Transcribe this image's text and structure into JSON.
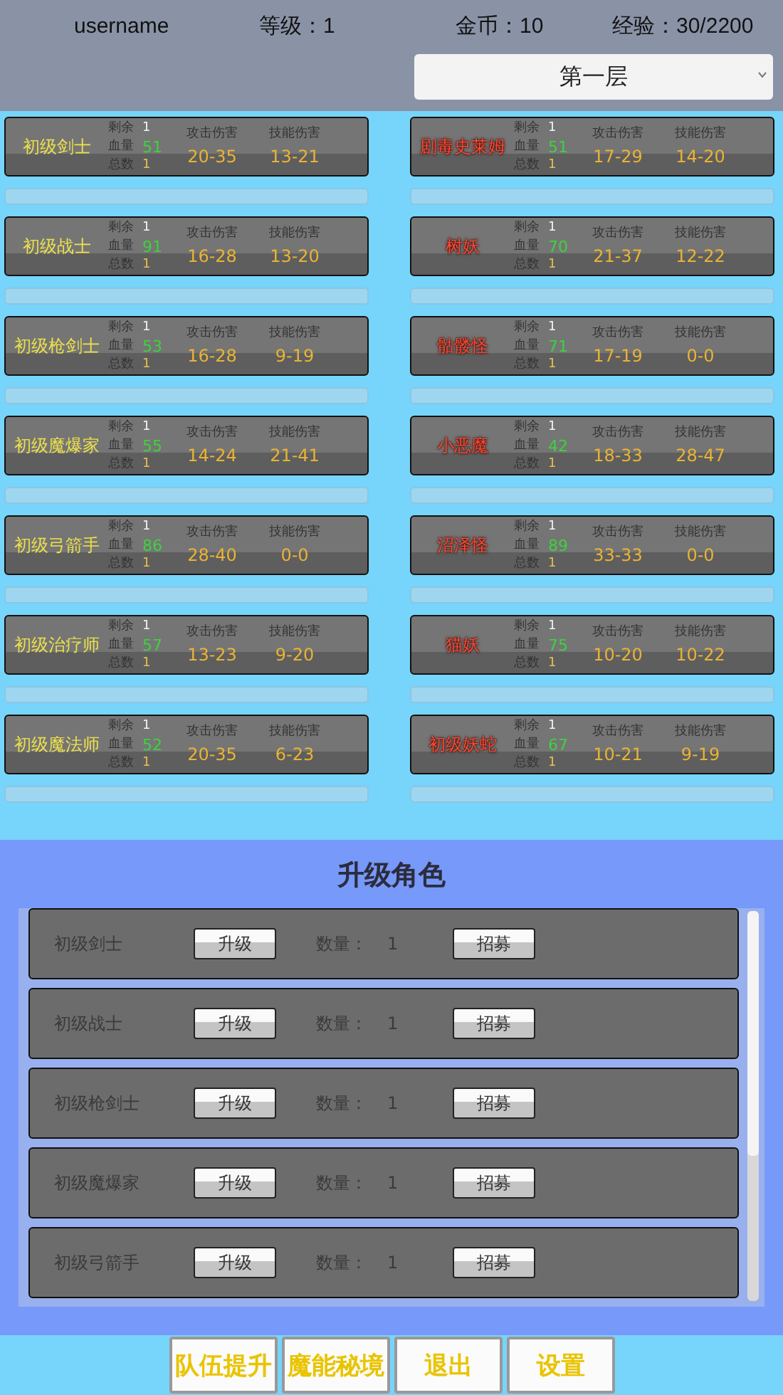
{
  "stats": [
    "username",
    "等级：1",
    "金币：10",
    "经验：30/2200"
  ],
  "floor_select": {
    "value": "第一层"
  },
  "heroes": [
    {
      "name": "初级剑士",
      "remaining_label": "剩余",
      "remaining": "1",
      "hp_label": "血量",
      "hp": "51",
      "total_label": "总数",
      "total": "1",
      "attack_label": "攻击伤害",
      "attack": "20-35",
      "skill_label": "技能伤害",
      "skill": "13-21"
    },
    {
      "name": "初级战士",
      "remaining_label": "剩余",
      "remaining": "1",
      "hp_label": "血量",
      "hp": "91",
      "total_label": "总数",
      "total": "1",
      "attack_label": "攻击伤害",
      "attack": "16-28",
      "skill_label": "技能伤害",
      "skill": "13-20"
    },
    {
      "name": "初级枪剑士",
      "remaining_label": "剩余",
      "remaining": "1",
      "hp_label": "血量",
      "hp": "53",
      "total_label": "总数",
      "total": "1",
      "attack_label": "攻击伤害",
      "attack": "16-28",
      "skill_label": "技能伤害",
      "skill": "9-19"
    },
    {
      "name": "初级魔爆家",
      "remaining_label": "剩余",
      "remaining": "1",
      "hp_label": "血量",
      "hp": "55",
      "total_label": "总数",
      "total": "1",
      "attack_label": "攻击伤害",
      "attack": "14-24",
      "skill_label": "技能伤害",
      "skill": "21-41"
    },
    {
      "name": "初级弓箭手",
      "remaining_label": "剩余",
      "remaining": "1",
      "hp_label": "血量",
      "hp": "86",
      "total_label": "总数",
      "total": "1",
      "attack_label": "攻击伤害",
      "attack": "28-40",
      "skill_label": "技能伤害",
      "skill": "0-0"
    },
    {
      "name": "初级治疗师",
      "remaining_label": "剩余",
      "remaining": "1",
      "hp_label": "血量",
      "hp": "57",
      "total_label": "总数",
      "total": "1",
      "attack_label": "攻击伤害",
      "attack": "13-23",
      "skill_label": "技能伤害",
      "skill": "9-20"
    },
    {
      "name": "初级魔法师",
      "remaining_label": "剩余",
      "remaining": "1",
      "hp_label": "血量",
      "hp": "52",
      "total_label": "总数",
      "total": "1",
      "attack_label": "攻击伤害",
      "attack": "20-35",
      "skill_label": "技能伤害",
      "skill": "6-23"
    }
  ],
  "monsters": [
    {
      "name": "剧毒史莱姆",
      "remaining_label": "剩余",
      "remaining": "1",
      "hp_label": "血量",
      "hp": "51",
      "total_label": "总数",
      "total": "1",
      "attack_label": "攻击伤害",
      "attack": "17-29",
      "skill_label": "技能伤害",
      "skill": "14-20"
    },
    {
      "name": "树妖",
      "remaining_label": "剩余",
      "remaining": "1",
      "hp_label": "血量",
      "hp": "70",
      "total_label": "总数",
      "total": "1",
      "attack_label": "攻击伤害",
      "attack": "21-37",
      "skill_label": "技能伤害",
      "skill": "12-22"
    },
    {
      "name": "骷髅怪",
      "remaining_label": "剩余",
      "remaining": "1",
      "hp_label": "血量",
      "hp": "71",
      "total_label": "总数",
      "total": "1",
      "attack_label": "攻击伤害",
      "attack": "17-19",
      "skill_label": "技能伤害",
      "skill": "0-0"
    },
    {
      "name": "小恶魔",
      "remaining_label": "剩余",
      "remaining": "1",
      "hp_label": "血量",
      "hp": "42",
      "total_label": "总数",
      "total": "1",
      "attack_label": "攻击伤害",
      "attack": "18-33",
      "skill_label": "技能伤害",
      "skill": "28-47"
    },
    {
      "name": "沼泽怪",
      "remaining_label": "剩余",
      "remaining": "1",
      "hp_label": "血量",
      "hp": "89",
      "total_label": "总数",
      "total": "1",
      "attack_label": "攻击伤害",
      "attack": "33-33",
      "skill_label": "技能伤害",
      "skill": "0-0"
    },
    {
      "name": "猫妖",
      "remaining_label": "剩余",
      "remaining": "1",
      "hp_label": "血量",
      "hp": "75",
      "total_label": "总数",
      "total": "1",
      "attack_label": "攻击伤害",
      "attack": "10-20",
      "skill_label": "技能伤害",
      "skill": "10-22"
    },
    {
      "name": "初级妖蛇",
      "remaining_label": "剩余",
      "remaining": "1",
      "hp_label": "血量",
      "hp": "67",
      "total_label": "总数",
      "total": "1",
      "attack_label": "攻击伤害",
      "attack": "10-21",
      "skill_label": "技能伤害",
      "skill": "9-19"
    }
  ],
  "upgrade": {
    "title": "升级角色",
    "rows": [
      {
        "name": "初级剑士",
        "upgrade_button": "升级",
        "count_label": "数量：",
        "count": "1",
        "recruit_button": "招募"
      },
      {
        "name": "初级战士",
        "upgrade_button": "升级",
        "count_label": "数量：",
        "count": "1",
        "recruit_button": "招募"
      },
      {
        "name": "初级枪剑士",
        "upgrade_button": "升级",
        "count_label": "数量：",
        "count": "1",
        "recruit_button": "招募"
      },
      {
        "name": "初级魔爆家",
        "upgrade_button": "升级",
        "count_label": "数量：",
        "count": "1",
        "recruit_button": "招募"
      },
      {
        "name": "初级弓箭手",
        "upgrade_button": "升级",
        "count_label": "数量：",
        "count": "1",
        "recruit_button": "招募"
      }
    ]
  },
  "bottom_buttons": [
    "队伍提升",
    "魔能秘境",
    "退出",
    "设置"
  ]
}
